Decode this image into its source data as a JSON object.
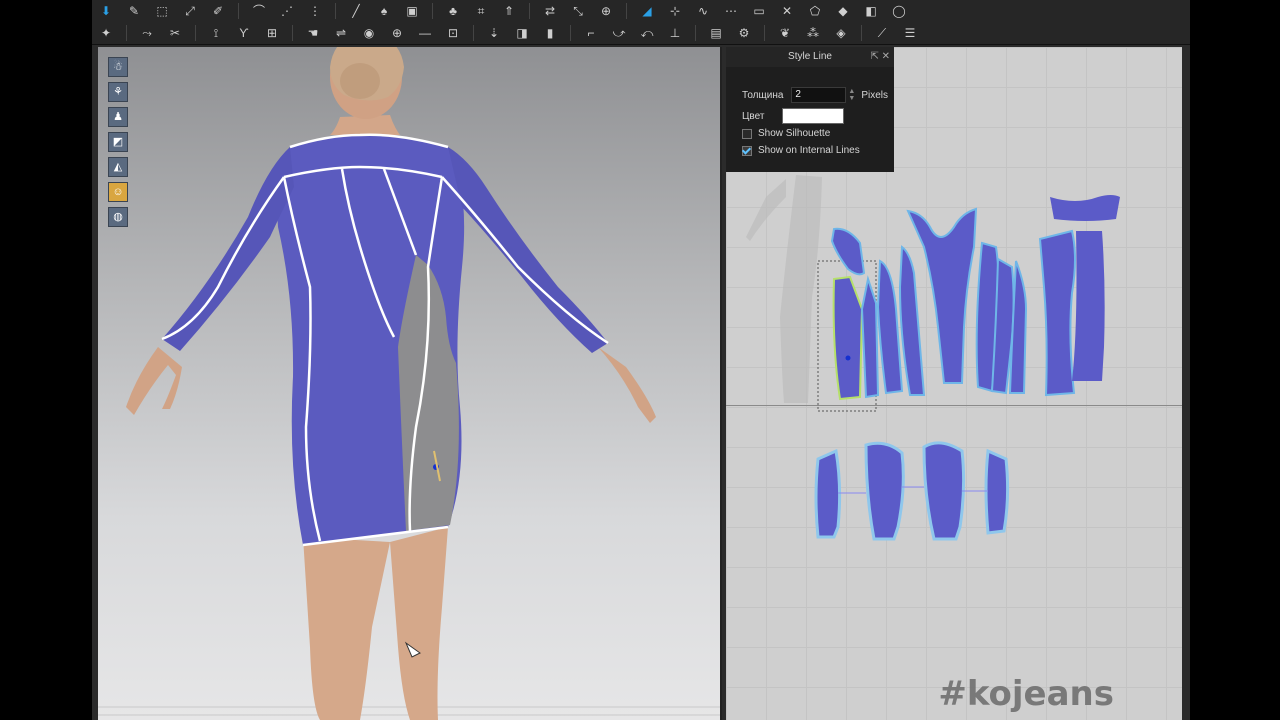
{
  "panel": {
    "title": "Style Line",
    "thickness_label": "Толщина",
    "thickness_value": "2",
    "thickness_unit": "Pixels",
    "color_label": "Цвет",
    "color_value": "#ffffff",
    "show_silhouette_label": "Show Silhouette",
    "show_silhouette_checked": false,
    "show_internal_label": "Show on Internal Lines",
    "show_internal_checked": true
  },
  "toolbar_icons_row1": [
    "move-icon",
    "brush-icon",
    "select-icon",
    "transform-icon",
    "edit-icon",
    "sew-icon",
    "pin-icon",
    "fold-icon"
  ],
  "toolbar_icons_row2": [
    "avatar-icon",
    "arrange-icon",
    "measure-icon",
    "line-icon",
    "tape-icon",
    "button-icon",
    "zip-icon",
    "texture-icon"
  ],
  "viewport_icons": [
    "avatar-display-icon",
    "garment-display-icon",
    "pose-icon",
    "texture-mode-icon",
    "mesh-icon",
    "skin-icon",
    "globe-icon"
  ],
  "colors": {
    "fabric": "#5b5bbf",
    "seam": "#ffffff",
    "panel_bg": "#1e1e1e",
    "accent": "#2aa0e6"
  },
  "watermark": "#kojeans"
}
